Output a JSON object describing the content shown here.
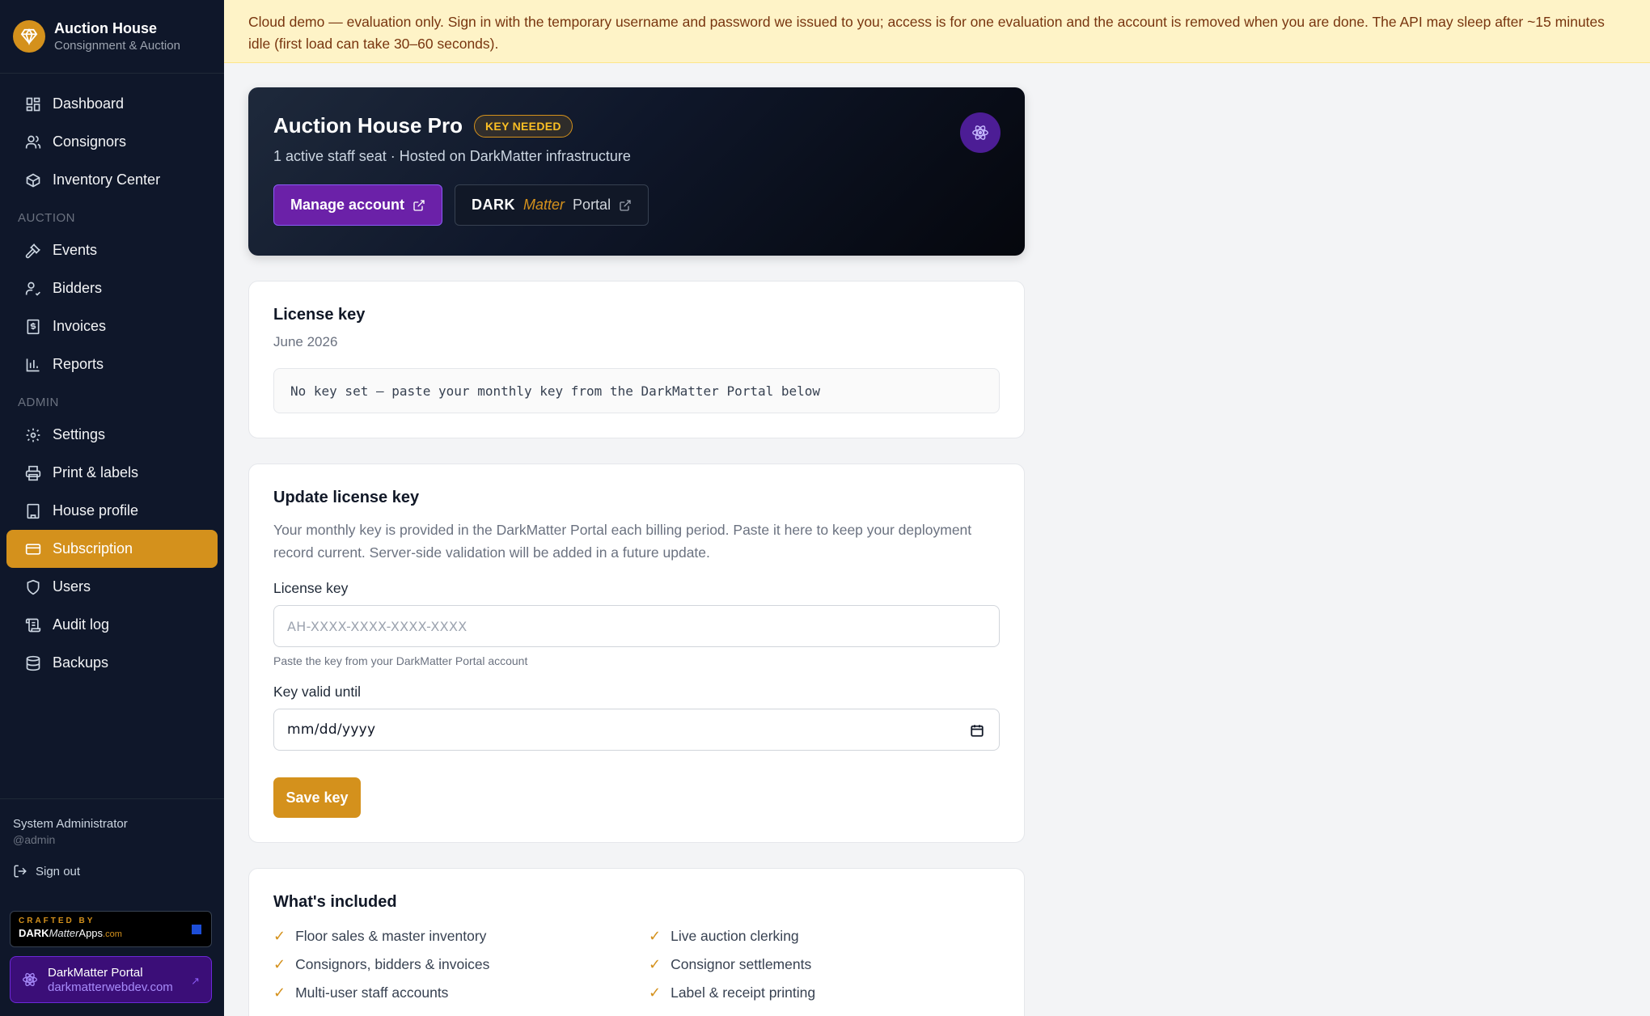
{
  "sidebar": {
    "brand": {
      "title": "Auction House",
      "subtitle": "Consignment & Auction"
    },
    "items_top": [
      {
        "label": "Dashboard",
        "icon": "dashboard-grid-icon"
      },
      {
        "label": "Consignors",
        "icon": "users-icon"
      },
      {
        "label": "Inventory Center",
        "icon": "box-icon"
      }
    ],
    "section_auction": "AUCTION",
    "items_auction": [
      {
        "label": "Events",
        "icon": "gavel-icon"
      },
      {
        "label": "Bidders",
        "icon": "user-check-icon"
      },
      {
        "label": "Invoices",
        "icon": "receipt-icon"
      },
      {
        "label": "Reports",
        "icon": "bar-chart-icon"
      }
    ],
    "section_admin": "ADMIN",
    "items_admin": [
      {
        "label": "Settings",
        "icon": "gear-icon"
      },
      {
        "label": "Print & labels",
        "icon": "printer-icon"
      },
      {
        "label": "House profile",
        "icon": "building-icon"
      },
      {
        "label": "Subscription",
        "icon": "credit-card-icon",
        "active": true
      },
      {
        "label": "Users",
        "icon": "shield-icon"
      },
      {
        "label": "Audit log",
        "icon": "scroll-icon"
      },
      {
        "label": "Backups",
        "icon": "database-icon"
      }
    ],
    "user": {
      "name": "System Administrator",
      "handle": "@admin"
    },
    "sign_out": "Sign out",
    "crafted": {
      "top": "CRAFTED BY",
      "dark": "DARK",
      "matter": "Matter",
      "apps": "Apps",
      "domain": ".com"
    },
    "portal": {
      "title": "DarkMatter Portal",
      "url": "darkmatterwebdev.com",
      "arrow": "↗"
    }
  },
  "banner": {
    "text": "Cloud demo — evaluation only. Sign in with the temporary username and password we issued to you; access is for one evaluation and the account is removed when you are done. The API may sleep after ~15 minutes idle (first load can take 30–60 seconds)."
  },
  "hero": {
    "title": "Auction House Pro",
    "badge": "KEY NEEDED",
    "subtitle": "1 active staff seat · Hosted on DarkMatter infrastructure",
    "manage_button": "Manage account",
    "portal_button": {
      "dark": "DARK",
      "matter": "Matter",
      "portal": "Portal"
    }
  },
  "license_card": {
    "title": "License key",
    "period": "June 2026",
    "key_status": "No key set — paste your monthly key from the DarkMatter Portal below"
  },
  "update_card": {
    "title": "Update license key",
    "description": "Your monthly key is provided in the DarkMatter Portal each billing period. Paste it here to keep your deployment record current. Server-side validation will be added in a future update.",
    "key_label": "License key",
    "key_placeholder": "AH-XXXX-XXXX-XXXX-XXXX",
    "key_hint": "Paste the key from your DarkMatter Portal account",
    "date_label": "Key valid until",
    "date_value": "mm/dd/yyyy",
    "save_button": "Save key"
  },
  "included_card": {
    "title": "What's included",
    "items": [
      "Floor sales & master inventory",
      "Live auction clerking",
      "Consignors, bidders & invoices",
      "Consignor settlements",
      "Multi-user staff accounts",
      "Label & receipt printing"
    ]
  },
  "colors": {
    "accent": "#d4911c",
    "sidebar_bg": "#0f172a",
    "purple": "#6b21a8",
    "banner_bg": "#fef3c7"
  }
}
